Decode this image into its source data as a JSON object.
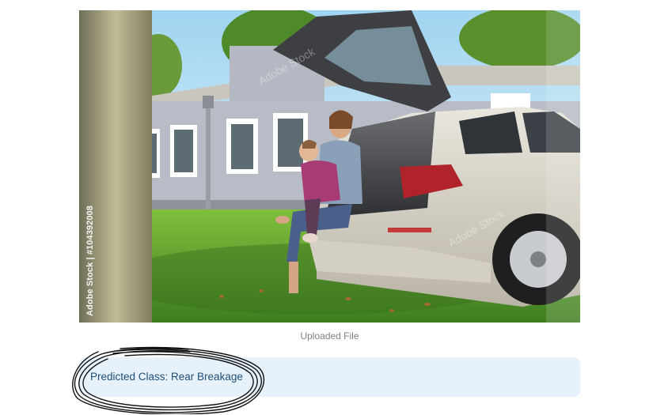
{
  "image": {
    "alt": "Mother with child sitting in open trunk of silver station wagon in front of house",
    "side_watermark": "Adobe Stock | #104392008",
    "overlay_watermark": "Adobe Stock"
  },
  "caption": "Uploaded File",
  "result": {
    "text": "Predicted Class: Rear Breakage"
  },
  "colors": {
    "alert_bg": "#e6f1fc",
    "alert_text": "#1c4f7a",
    "caption_text": "#7b7f86"
  }
}
